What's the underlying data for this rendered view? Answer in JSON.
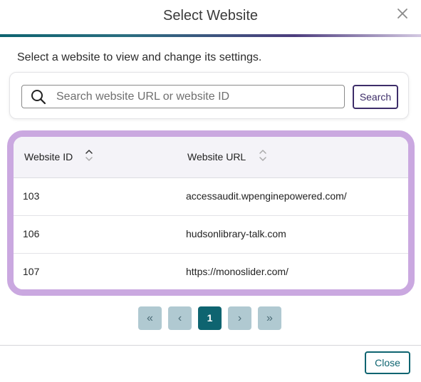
{
  "dialog": {
    "title": "Select Website",
    "intro": "Select a website to view and change its settings."
  },
  "search": {
    "placeholder": "Search website URL or website ID",
    "value": "",
    "button_label": "Search"
  },
  "table": {
    "columns": [
      "Website ID",
      "Website URL"
    ],
    "rows": [
      {
        "id": "103",
        "url": "accessaudit.wpenginepowered.com/"
      },
      {
        "id": "106",
        "url": "hudsonlibrary-talk.com"
      },
      {
        "id": "107",
        "url": "https://monoslider.com/"
      }
    ]
  },
  "pagination": {
    "first": "«",
    "prev": "‹",
    "current": "1",
    "next": "›",
    "last": "»"
  },
  "footer": {
    "close_label": "Close"
  },
  "colors": {
    "accent": "#0e6470",
    "purple": "#3d2d69",
    "highlight": "#caa8e0"
  },
  "icons": {
    "close": "close-icon",
    "search": "search-icon",
    "sort": "sort-icon"
  }
}
